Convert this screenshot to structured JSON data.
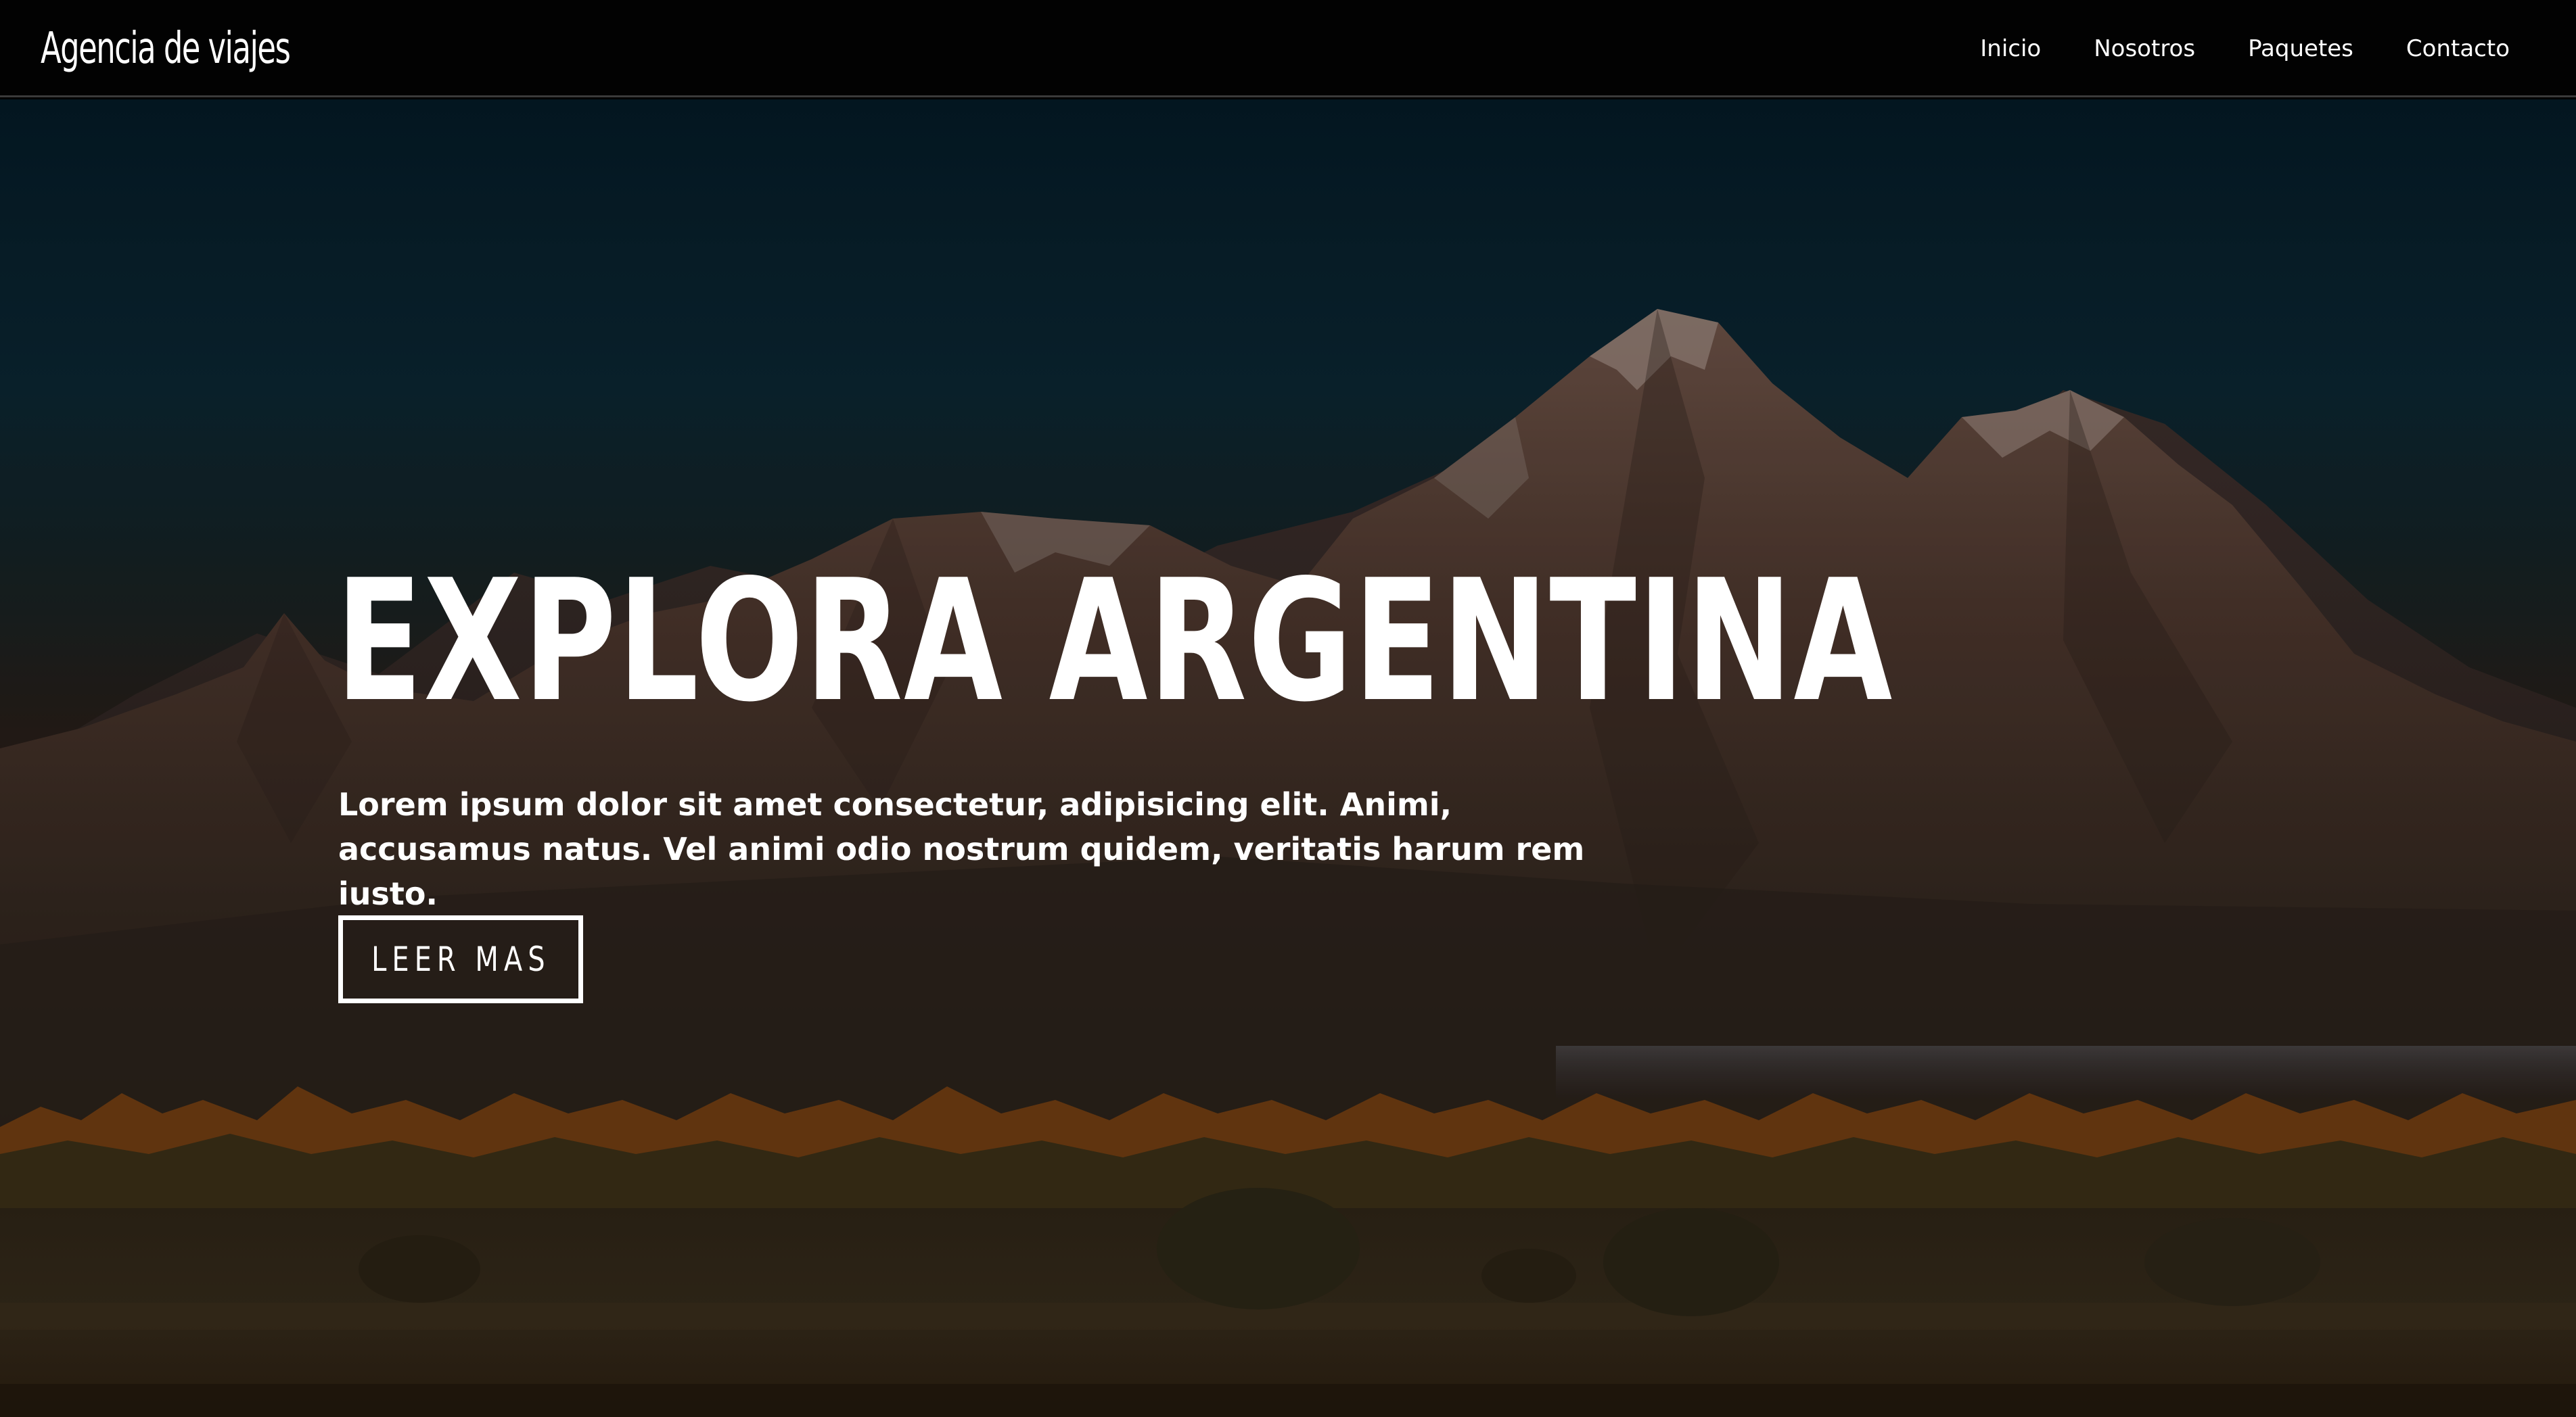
{
  "brand": {
    "title": "Agencia de viajes"
  },
  "nav": {
    "items": [
      {
        "label": "Inicio"
      },
      {
        "label": "Nosotros"
      },
      {
        "label": "Paquetes"
      },
      {
        "label": "Contacto"
      }
    ]
  },
  "hero": {
    "title": "EXPLORA ARGENTINA",
    "text": "Lorem ipsum dolor sit amet consectetur, adipisicing elit. Animi, accusamus natus. Vel animi odio nostrum quidem, veritatis harum rem iusto.",
    "button_label": "LEER MAS"
  },
  "colors": {
    "navbar_bg": "#020202",
    "text": "#ffffff",
    "sky_top": "#041a25",
    "mountain": "#5a4033",
    "foliage": "#8a4a14",
    "ground": "#2a1f12"
  }
}
